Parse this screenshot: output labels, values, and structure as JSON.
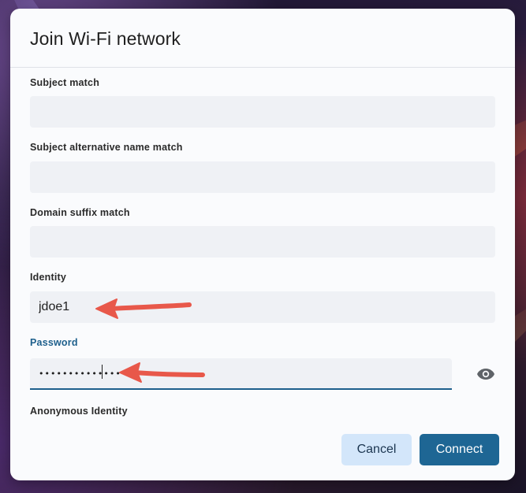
{
  "dialog": {
    "title": "Join Wi-Fi network",
    "fields": [
      {
        "label": "Subject match",
        "value": "",
        "placeholder": ""
      },
      {
        "label": "Subject alternative name match",
        "value": "",
        "placeholder": ""
      },
      {
        "label": "Domain suffix match",
        "value": "",
        "placeholder": ""
      },
      {
        "label": "Identity",
        "value": "jdoe1",
        "placeholder": ""
      },
      {
        "label": "Password",
        "value": "•••••••••••••••",
        "placeholder": ""
      },
      {
        "label": "Anonymous Identity",
        "value": "",
        "placeholder": ""
      }
    ],
    "buttons": {
      "cancel": "Cancel",
      "connect": "Connect"
    }
  },
  "icons": {
    "password_toggle": "eye-icon",
    "annotation": "red-arrow-icon"
  },
  "colors": {
    "accent": "#1e6694",
    "focus_label": "#1d5f8c",
    "cancel_bg": "#d3e6fa",
    "annotation_arrow": "#e8584a"
  }
}
